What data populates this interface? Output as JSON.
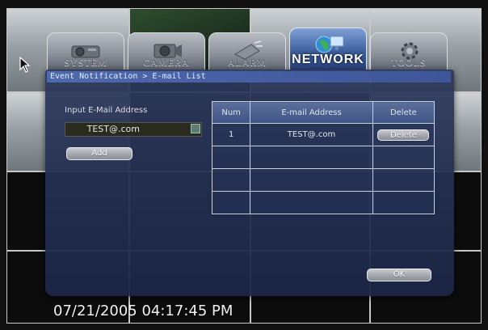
{
  "tabs": [
    {
      "label": "SYSTEM",
      "icon": "projector-icon",
      "active": false
    },
    {
      "label": "CAMERA",
      "icon": "camera-icon",
      "active": false
    },
    {
      "label": "ALARM",
      "icon": "alarm-icon",
      "active": false
    },
    {
      "label": "NETWORK",
      "icon": "network-icon",
      "active": true
    },
    {
      "label": "TOOLS",
      "icon": "gear-icon",
      "active": false
    }
  ],
  "breadcrumb": "Event Notification > E-mail List",
  "input_section": {
    "label": "Input E-Mail Address",
    "email_value": "TEST@.com",
    "add_label": "Add"
  },
  "table": {
    "headers": {
      "num": "Num",
      "email": "E-mail Address",
      "delete": "Delete"
    },
    "rows": [
      {
        "num": "1",
        "email": "TEST@.com",
        "delete_label": "Delete"
      },
      {
        "num": "",
        "email": "",
        "delete_label": ""
      },
      {
        "num": "",
        "email": "",
        "delete_label": ""
      },
      {
        "num": "",
        "email": "",
        "delete_label": ""
      }
    ]
  },
  "ok_label": "OK",
  "timestamp": "07/21/2005 04:17:45 PM",
  "colors": {
    "active_tab": "#3e5f9e",
    "dialog_bg": "#2c385c",
    "breadcrumb_bg": "#4f69ad"
  }
}
